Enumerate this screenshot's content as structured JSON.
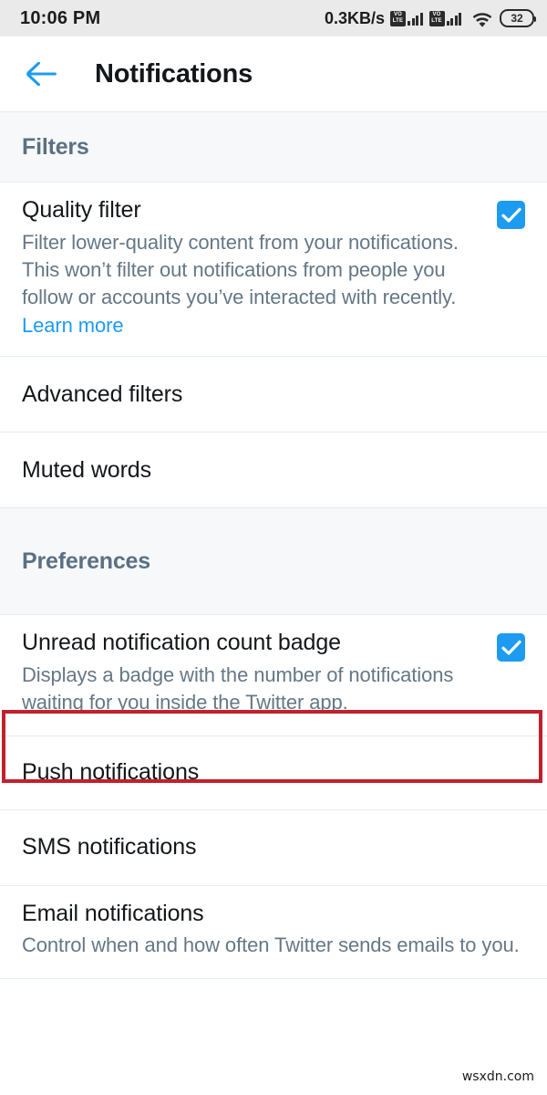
{
  "status_bar": {
    "time": "10:06 PM",
    "network_speed": "0.3KB/s",
    "volte_top": "VO",
    "volte_bottom": "LTE",
    "battery_level": "32",
    "icons": [
      "volte-icon",
      "signal-bars-icon",
      "volte-icon",
      "signal-bars-icon",
      "wifi-icon",
      "battery-icon"
    ]
  },
  "app_bar": {
    "title": "Notifications",
    "back_icon": "back-arrow-icon"
  },
  "sections": [
    {
      "id": "filters",
      "header": "Filters",
      "rows": [
        {
          "title": "Quality filter",
          "desc_before": "Filter lower-quality content from your notifications. This won’t filter out notifications from people you follow or accounts you’ve interacted with recently. ",
          "link": "Learn more",
          "checkbox": true
        },
        {
          "title": "Advanced filters"
        },
        {
          "title": "Muted words"
        }
      ]
    },
    {
      "id": "preferences",
      "header": "Preferences",
      "rows": [
        {
          "title": "Unread notification count badge",
          "desc": "Displays a badge with the number of notifications waiting for you inside the Twitter app.",
          "checkbox": true
        },
        {
          "title": "Push notifications",
          "highlighted": true
        },
        {
          "title": "SMS notifications"
        },
        {
          "title": "Email notifications",
          "desc": "Control when and how often Twitter sends emails to you."
        }
      ]
    }
  ],
  "colors": {
    "accent": "#1d9bf0",
    "section_header_text": "#5b7083",
    "secondary_text": "#657786",
    "primary_text": "#14171a",
    "divider": "#e6ecf0",
    "section_bg": "#f6f8f9",
    "status_bar_bg": "#eaeaea",
    "highlight_border": "#c2202b"
  },
  "watermark": "wsxdn.com"
}
